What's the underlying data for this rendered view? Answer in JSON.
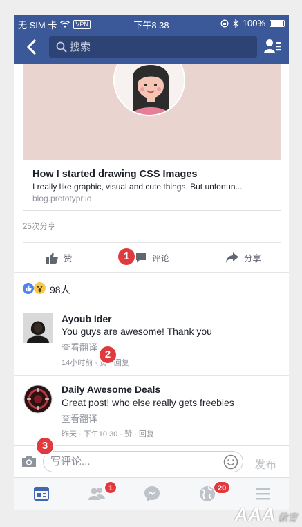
{
  "status_bar": {
    "carrier": "无 SIM 卡",
    "vpn": "VPN",
    "time": "下午8:38",
    "battery": "100%"
  },
  "nav": {
    "search_placeholder": "搜索"
  },
  "link_card": {
    "title": "How I started drawing CSS Images",
    "description": "I really like graphic, visual and cute things. But unfortun...",
    "url": "blog.prototypr.io"
  },
  "shares_count": "25次分享",
  "actions": {
    "like": "赞",
    "comment": "评论",
    "share": "分享"
  },
  "reactions": {
    "count": "98人"
  },
  "comments": [
    {
      "name": "Ayoub Ider",
      "text": "You guys are awesome! Thank you",
      "translate": "查看翻译",
      "meta": "14小时前 · 赞 · 回复"
    },
    {
      "name": "Daily Awesome Deals",
      "text": "Great post! who else really gets freebies",
      "translate": "查看翻译",
      "meta": "昨天 · 下午10:30 · 赞 · 回复"
    }
  ],
  "annotations": [
    "1",
    "2",
    "3"
  ],
  "composer": {
    "placeholder": "写评论...",
    "send_label": "发布"
  },
  "tabbar": {
    "friends_badge": "1",
    "notifications_badge": "20"
  },
  "watermark": {
    "text": "AAA",
    "sub": "教育"
  },
  "colors": {
    "brand": "#3b5998",
    "badge": "#e0393e",
    "muted": "#90949c"
  }
}
